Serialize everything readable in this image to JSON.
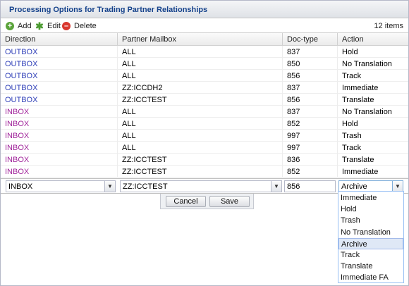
{
  "panel": {
    "title": "Processing Options for Trading Partner Relationships"
  },
  "toolbar": {
    "add_label": "Add",
    "edit_label": "Edit",
    "delete_label": "Delete",
    "count": "12 items",
    "icons": {
      "add": "plus-icon",
      "edit": "edit-icon",
      "delete": "minus-icon"
    }
  },
  "grid": {
    "columns": [
      "Direction",
      "Partner Mailbox",
      "Doc-type",
      "Action"
    ],
    "rows": [
      {
        "direction": "OUTBOX",
        "mailbox": "ALL",
        "doctype": "837",
        "action": "Hold"
      },
      {
        "direction": "OUTBOX",
        "mailbox": "ALL",
        "doctype": "850",
        "action": "No Translation"
      },
      {
        "direction": "OUTBOX",
        "mailbox": "ALL",
        "doctype": "856",
        "action": "Track"
      },
      {
        "direction": "OUTBOX",
        "mailbox": "ZZ:ICCDH2",
        "doctype": "837",
        "action": "Immediate"
      },
      {
        "direction": "OUTBOX",
        "mailbox": "ZZ:ICCTEST",
        "doctype": "856",
        "action": "Translate"
      },
      {
        "direction": "INBOX",
        "mailbox": "ALL",
        "doctype": "837",
        "action": "No Translation"
      },
      {
        "direction": "INBOX",
        "mailbox": "ALL",
        "doctype": "852",
        "action": "Hold"
      },
      {
        "direction": "INBOX",
        "mailbox": "ALL",
        "doctype": "997",
        "action": "Trash"
      },
      {
        "direction": "INBOX",
        "mailbox": "ALL",
        "doctype": "997",
        "action": "Track"
      },
      {
        "direction": "INBOX",
        "mailbox": "ZZ:ICCTEST",
        "doctype": "836",
        "action": "Translate"
      },
      {
        "direction": "INBOX",
        "mailbox": "ZZ:ICCTEST",
        "doctype": "852",
        "action": "Immediate"
      }
    ]
  },
  "editor": {
    "direction": "INBOX",
    "mailbox": "ZZ:ICCTEST",
    "doctype": "856",
    "action": "Archive"
  },
  "buttons": {
    "cancel": "Cancel",
    "save": "Save"
  },
  "action_options": [
    "Immediate",
    "Hold",
    "Trash",
    "No Translation",
    "Archive",
    "Track",
    "Translate",
    "Immediate FA"
  ],
  "action_selected": "Archive",
  "colors": {
    "outbox": "#2f3fb8",
    "inbox": "#a1259b",
    "title": "#15428b",
    "selected_option": "#dfe8f6"
  }
}
